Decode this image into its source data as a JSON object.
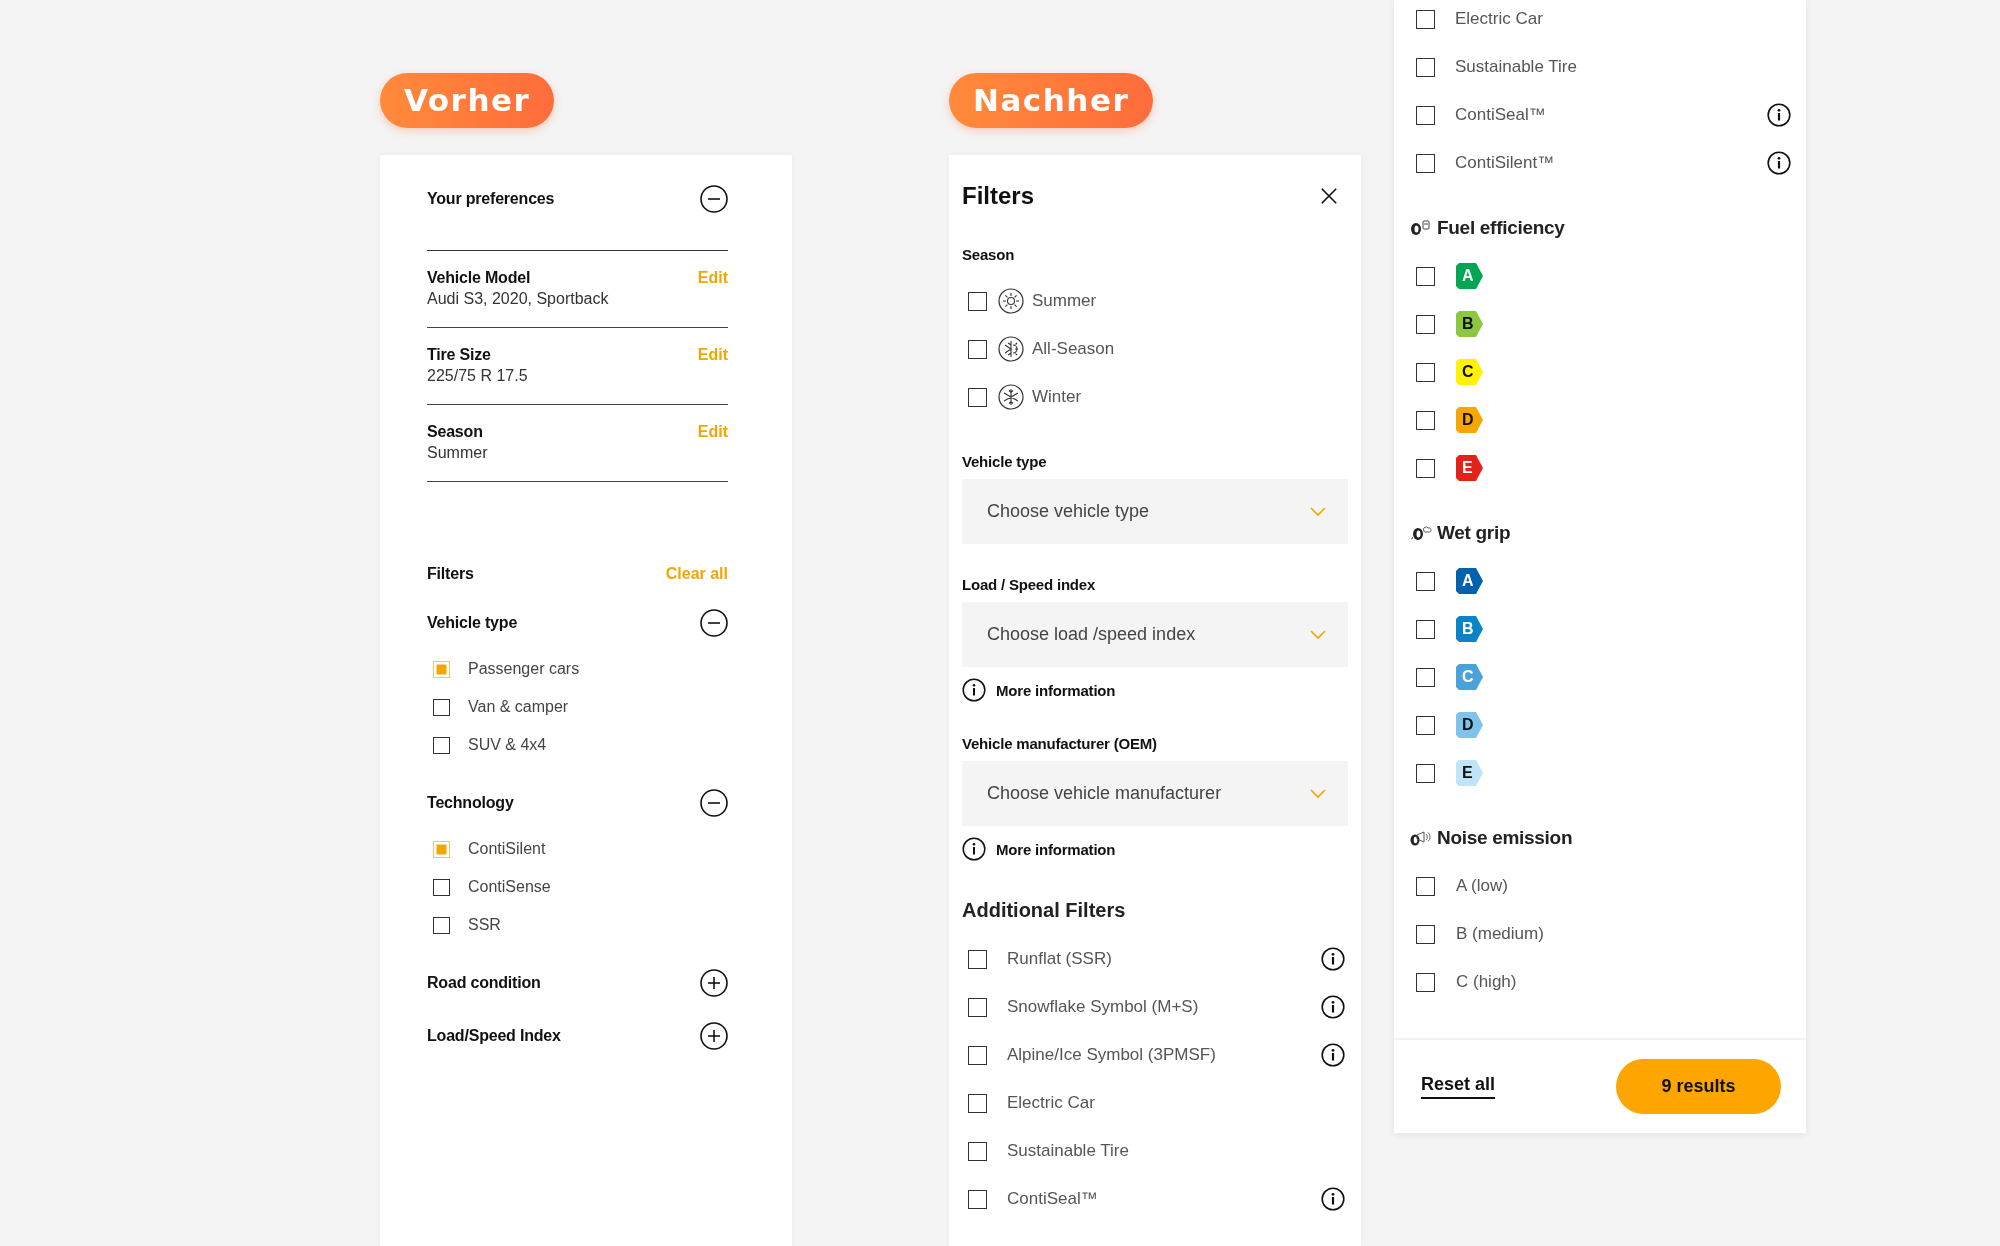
{
  "before": {
    "badge": "Vorher",
    "preferences": {
      "title": "Your preferences",
      "expanded": true,
      "items": [
        {
          "label": "Vehicle Model",
          "value": "Audi S3, 2020, Sportback",
          "action": "Edit"
        },
        {
          "label": "Tire Size",
          "value": "225/75 R 17.5",
          "action": "Edit"
        },
        {
          "label": "Season",
          "value": "Summer",
          "action": "Edit"
        }
      ]
    },
    "filters": {
      "title": "Filters",
      "clear": "Clear all",
      "groups": [
        {
          "title": "Vehicle type",
          "expanded": true,
          "options": [
            {
              "label": "Passenger cars",
              "checked": true
            },
            {
              "label": "Van & camper",
              "checked": false
            },
            {
              "label": "SUV & 4x4",
              "checked": false
            }
          ]
        },
        {
          "title": "Technology",
          "expanded": true,
          "options": [
            {
              "label": "ContiSilent",
              "checked": true
            },
            {
              "label": "ContiSense",
              "checked": false
            },
            {
              "label": "SSR",
              "checked": false
            }
          ]
        },
        {
          "title": "Road condition",
          "expanded": false
        },
        {
          "title": "Load/Speed Index",
          "expanded": false
        }
      ]
    }
  },
  "after": {
    "badge": "Nachher",
    "title": "Filters",
    "season": {
      "label": "Season",
      "options": [
        {
          "label": "Summer",
          "kind": "sun",
          "checked": false
        },
        {
          "label": "All-Season",
          "kind": "allseason",
          "checked": false
        },
        {
          "label": "Winter",
          "kind": "snow",
          "checked": false
        }
      ]
    },
    "selects": [
      {
        "label": "Vehicle type",
        "placeholder": "Choose vehicle type"
      },
      {
        "label": "Load / Speed index",
        "placeholder": "Choose load /speed index",
        "info": "More information"
      },
      {
        "label": "Vehicle manufacturer (OEM)",
        "placeholder": "Choose vehicle manufacturer",
        "info": "More information"
      }
    ],
    "additional": {
      "title": "Additional Filters",
      "options": [
        {
          "label": "Runflat (SSR)",
          "checked": false,
          "info": true
        },
        {
          "label": "Snowflake Symbol (M+S)",
          "checked": false,
          "info": true
        },
        {
          "label": "Alpine/Ice Symbol (3PMSF)",
          "checked": false,
          "info": true
        },
        {
          "label": "Electric Car",
          "checked": false,
          "info": false
        },
        {
          "label": "Sustainable Tire",
          "checked": false,
          "info": false
        },
        {
          "label": "ContiSeal™",
          "checked": false,
          "info": true
        }
      ]
    }
  },
  "continued": {
    "options": [
      {
        "label": "Electric Car",
        "checked": false,
        "info": false
      },
      {
        "label": "Sustainable Tire",
        "checked": false,
        "info": false
      },
      {
        "label": "ContiSeal™",
        "checked": false,
        "info": true
      },
      {
        "label": "ContiSilent™",
        "checked": false,
        "info": true
      }
    ],
    "rating_groups": [
      {
        "title": "Fuel efficiency",
        "kind": "fuel",
        "grades": [
          {
            "label": "A",
            "color": "#00a651",
            "checked": false
          },
          {
            "label": "B",
            "color": "#8dc63f",
            "checked": false
          },
          {
            "label": "C",
            "color": "#fff200",
            "checked": false
          },
          {
            "label": "D",
            "color": "#f7a600",
            "checked": false
          },
          {
            "label": "E",
            "color": "#e2231a",
            "checked": false
          }
        ]
      },
      {
        "title": "Wet grip",
        "kind": "wet",
        "grades": [
          {
            "label": "A",
            "color": "#0061ae",
            "checked": false
          },
          {
            "label": "B",
            "color": "#0a84c6",
            "checked": false
          },
          {
            "label": "C",
            "color": "#4aa3d8",
            "checked": false
          },
          {
            "label": "D",
            "color": "#7fc2ea",
            "checked": false
          },
          {
            "label": "E",
            "color": "#bfe3f7",
            "checked": false
          }
        ]
      }
    ],
    "noise": {
      "title": "Noise emission",
      "options": [
        {
          "label": "A (low)",
          "checked": false
        },
        {
          "label": "B (medium)",
          "checked": false
        },
        {
          "label": "C (high)",
          "checked": false
        }
      ]
    },
    "reset": "Reset all",
    "results": "9 results"
  }
}
